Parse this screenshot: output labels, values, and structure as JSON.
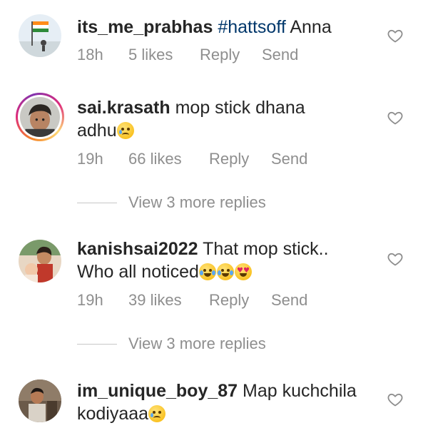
{
  "comments": [
    {
      "username": "its_me_prabhas",
      "hashtag": "#hattsoff",
      "text": " Anna",
      "time": "18h",
      "likes": "5 likes",
      "reply": "Reply",
      "send": "Send"
    },
    {
      "username": "sai.krasath",
      "text": " mop stick dhana adhu",
      "emoji": "crying-face",
      "time": "19h",
      "likes": "66 likes",
      "reply": "Reply",
      "send": "Send",
      "view_more": "View 3 more replies"
    },
    {
      "username": "kanishsai2022",
      "text": " That mop stick.. Who all noticed",
      "emojis": [
        "face-with-tears-of-joy",
        "face-with-tears-of-joy",
        "heart-eyes"
      ],
      "time": "19h",
      "likes": "39 likes",
      "reply": "Reply",
      "send": "Send",
      "view_more": "View 3 more replies"
    },
    {
      "username": "im_unique_boy_87",
      "text": " Map kuchchila kodiyaaa",
      "emoji": "crying-face"
    }
  ],
  "icons": {
    "like": "heart-outline-icon"
  },
  "colors": {
    "text": "#262626",
    "meta": "#8e8e8e",
    "hashtag": "#00376b"
  }
}
